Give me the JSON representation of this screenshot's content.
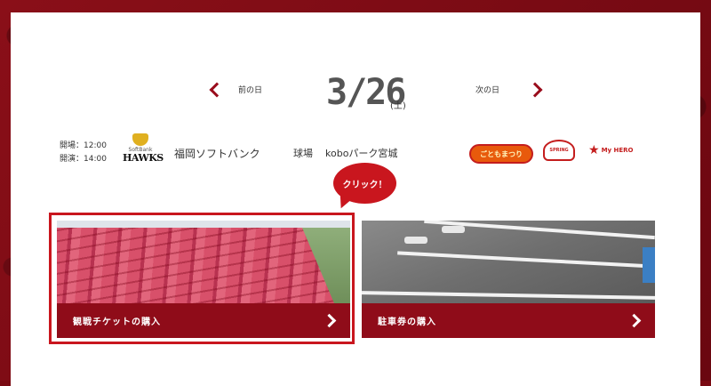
{
  "date_nav": {
    "prev_label": "前の日",
    "next_label": "次の日",
    "date": "3/26",
    "weekday": "(土)"
  },
  "game_info": {
    "open_time": "開場：12:00",
    "start_time": "開演：14:00",
    "team_logo_top": "SoftBank",
    "team_logo_main": "HAWKS",
    "opponent": "福岡ソフトバンク",
    "stadium_label": "球場",
    "stadium_value": "koboパーク宮城",
    "event_logos": [
      "ごともまつり",
      "SPRING",
      "My HERO"
    ]
  },
  "callout": {
    "text": "クリック！"
  },
  "cards": [
    {
      "label": "観戦チケットの購入"
    },
    {
      "label": "駐車券の購入"
    }
  ],
  "colors": {
    "brand": "#8f0c19",
    "accent": "#c9161e",
    "background": "#7a0a12"
  }
}
